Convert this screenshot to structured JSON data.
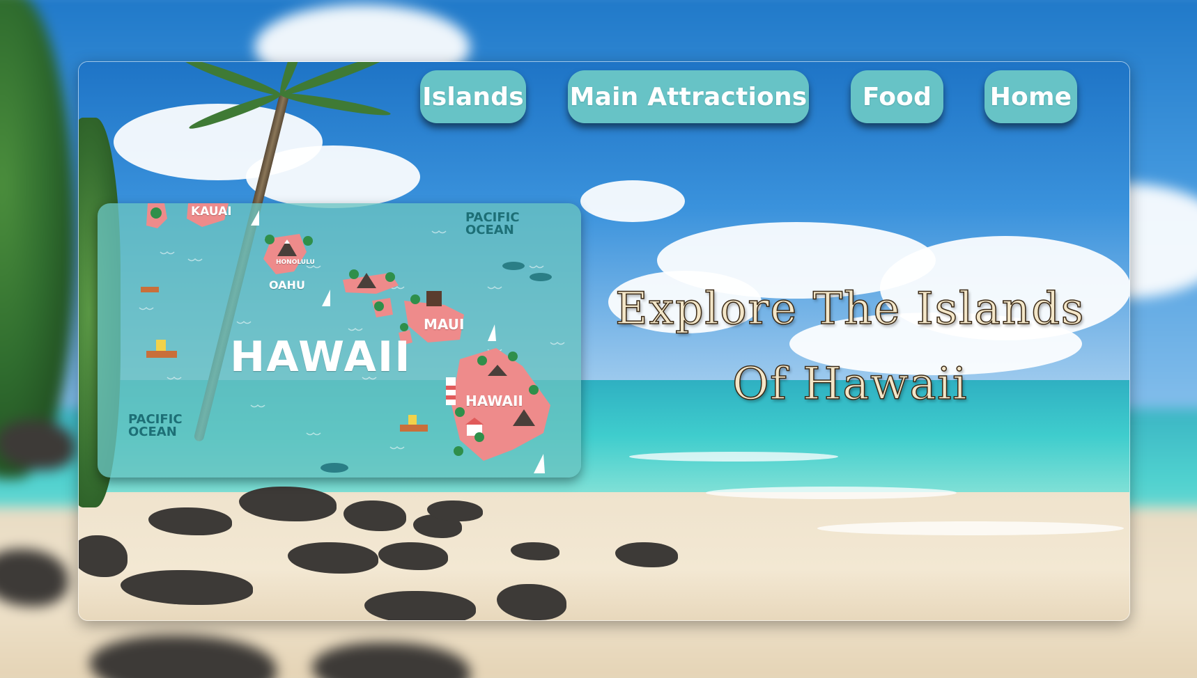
{
  "nav": {
    "items": [
      {
        "label": "Islands"
      },
      {
        "label": "Main Attractions"
      },
      {
        "label": "Food"
      },
      {
        "label": "Home"
      }
    ]
  },
  "map": {
    "labels": {
      "kauai": "KAUAI",
      "honolulu": "HONOLULU",
      "oahu": "OAHU",
      "maui": "MAUI",
      "hawaii_big": "HAWAII",
      "hawaii_island": "HAWAII",
      "pacific_ocean_top": "PACIFIC\nOCEAN",
      "pacific_ocean_bottom": "PACIFIC\nOCEAN"
    },
    "colors": {
      "card": "#69c3c0",
      "island": "#ee8b8b",
      "ocean_text": "#1d6f76"
    }
  },
  "hero": {
    "line1": "Explore The Islands",
    "line2": "Of Hawaii"
  },
  "colors": {
    "button_bg": "#67c3c6",
    "button_text": "#ffffff",
    "headline_fill": "#f3e6c8",
    "headline_outline": "#3b2a16"
  }
}
